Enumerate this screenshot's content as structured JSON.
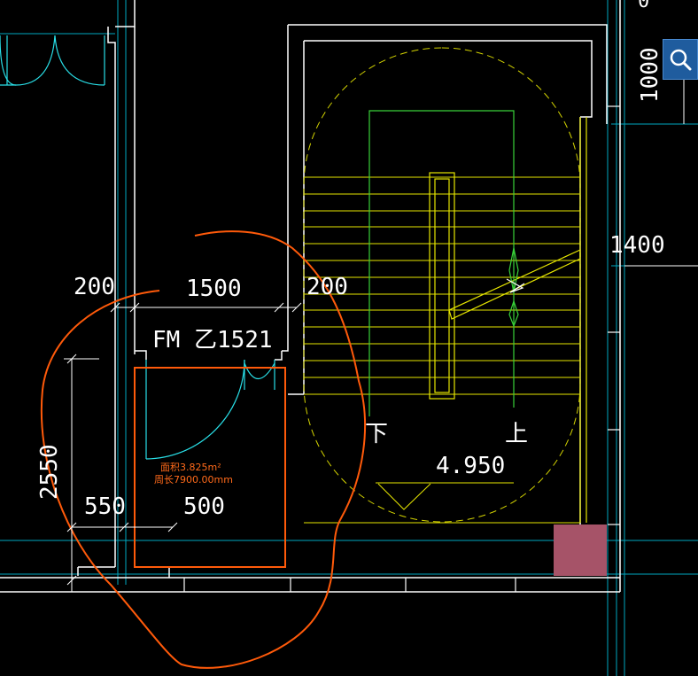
{
  "drawing": {
    "dims": {
      "left_wall": "200",
      "door_width": "1500",
      "right_wall": "200",
      "height": "2550",
      "small_left": "550",
      "small_right": "500",
      "stair_right": "1400",
      "top_right": "1000"
    },
    "door_tag": "FM 乙1521",
    "area_label": "面积3.825m²",
    "perimeter_label": "周长7900.00mm",
    "stair_down": "下",
    "stair_up": "上",
    "elevation": "4.950"
  },
  "colors": {
    "wall": "#ffffff",
    "grid": "#00b4c8",
    "stair": "#e6e600",
    "handrail": "#39d139",
    "door": "#29e0e8",
    "highlight": "#ff5a0a",
    "swatch": "#a65368",
    "search": "#1f5c9e"
  },
  "icons": {
    "search": "search-icon"
  }
}
